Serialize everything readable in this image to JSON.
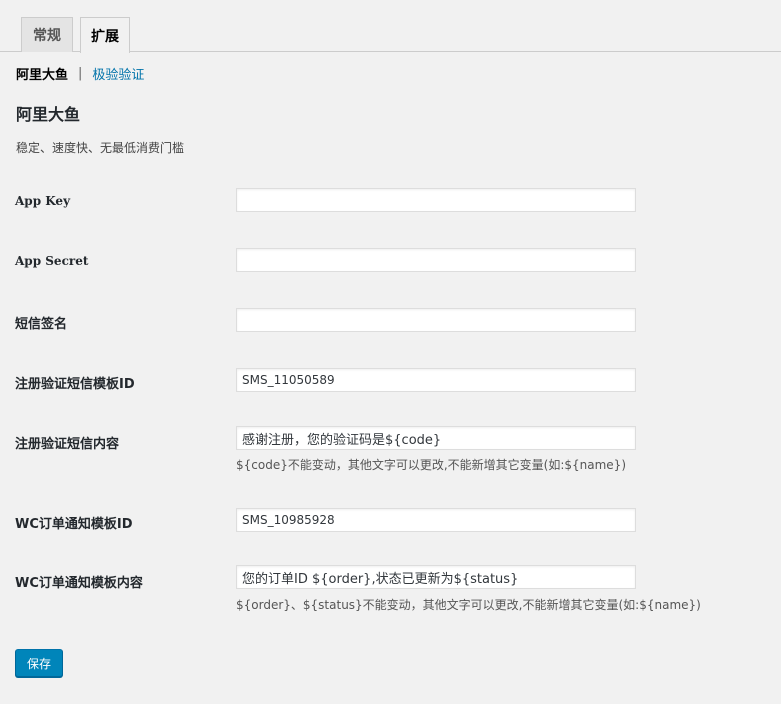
{
  "tabs": [
    {
      "label": "常规",
      "active": false
    },
    {
      "label": "扩展",
      "active": true
    }
  ],
  "subnav": {
    "current": "阿里大鱼",
    "separator": "|",
    "link": "极验验证"
  },
  "section": {
    "title": "阿里大鱼",
    "description": "稳定、速度快、无最低消费门槛"
  },
  "fields": {
    "app_key": {
      "label": "App Key",
      "value": ""
    },
    "app_secret": {
      "label": "App Secret",
      "value": ""
    },
    "sms_signature": {
      "label": "短信签名",
      "value": ""
    },
    "register_template_id": {
      "label": "注册验证短信模板ID",
      "value": "SMS_11050589"
    },
    "register_content": {
      "label": "注册验证短信内容",
      "value": "感谢注册，您的验证码是${code}",
      "hint": "${code}不能变动，其他文字可以更改,不能新增其它变量(如:${name})"
    },
    "wc_template_id": {
      "label": "WC订单通知模板ID",
      "value": "SMS_10985928"
    },
    "wc_content": {
      "label": "WC订单通知模板内容",
      "value": "您的订单ID ${order},状态已更新为${status}",
      "hint": "${order}、${status}不能变动，其他文字可以更改,不能新增其它变量(如:${name})"
    }
  },
  "save_label": "保存",
  "colors": {
    "background": "#f1f1f1",
    "link": "#0073aa",
    "primary_button": "#0085ba"
  }
}
